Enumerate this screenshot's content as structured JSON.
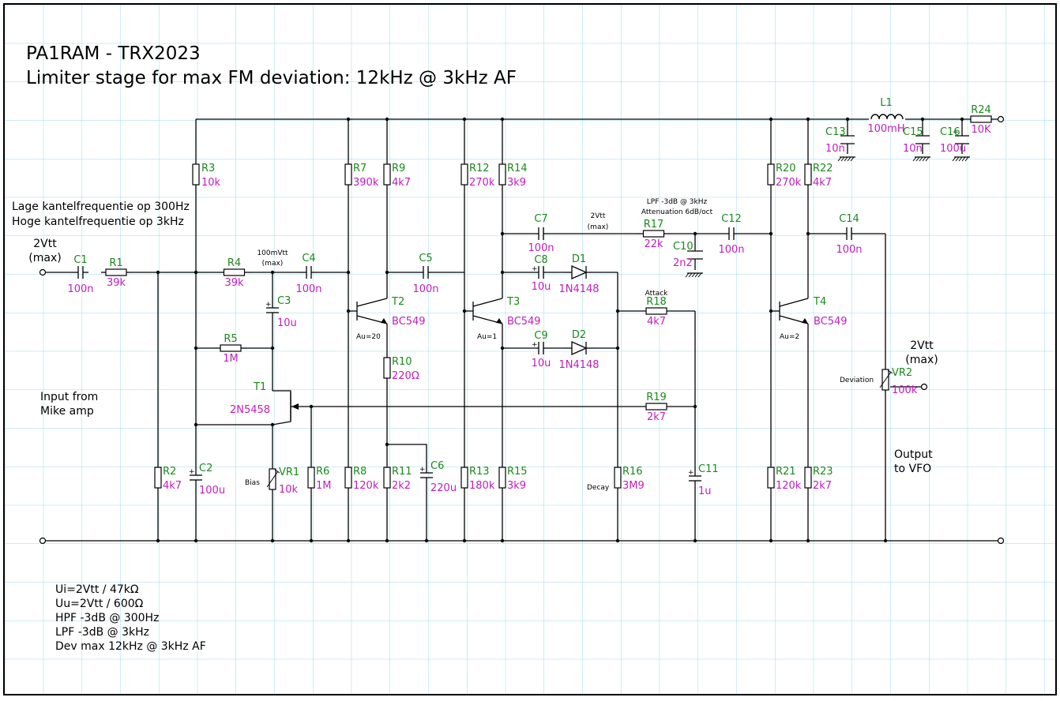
{
  "title": {
    "line1": "PA1RAM - TRX2023",
    "line2": "Limiter stage for max FM deviation: 12kHz @ 3kHz AF"
  },
  "notes": {
    "filter1": "Lage kantelfrequentie op 300Hz",
    "filter2": "Hoge kantelfrequentie op 3kHz",
    "input_level": "2Vtt",
    "input_level_max": "(max)",
    "input_from1": "Input from",
    "input_from2": "Mike amp",
    "mid_level": "100mVtt",
    "mid_level_max": "(max)",
    "lpf_note1": "LPF -3dB @ 3kHz",
    "lpf_note2": "Attenuation 6dB/oct",
    "c7_level": "2Vtt",
    "c7_level_max": "(max)",
    "out_level": "2Vtt",
    "out_level_max": "(max)",
    "output1": "Output",
    "output2": "to VFO",
    "gain_t2": "Au=20",
    "gain_t3": "Au=1",
    "gain_t4": "Au=2",
    "attack": "Attack",
    "decay": "Decay",
    "bias": "Bias",
    "deviation": "Deviation",
    "summary": [
      "Ui=2Vtt / 47kΩ",
      "Uu=2Vtt / 600Ω",
      "HPF -3dB @ 300Hz",
      "LPF -3dB @ 3kHz",
      "Dev max 12kHz @ 3kHz AF"
    ]
  },
  "components": {
    "R1": {
      "ref": "R1",
      "val": "39k"
    },
    "R2": {
      "ref": "R2",
      "val": "4k7"
    },
    "R3": {
      "ref": "R3",
      "val": "10k"
    },
    "R4": {
      "ref": "R4",
      "val": "39k"
    },
    "R5": {
      "ref": "R5",
      "val": "1M"
    },
    "R6": {
      "ref": "R6",
      "val": "1M"
    },
    "R7": {
      "ref": "R7",
      "val": "390k"
    },
    "R8": {
      "ref": "R8",
      "val": "120k"
    },
    "R9": {
      "ref": "R9",
      "val": "4k7"
    },
    "R10": {
      "ref": "R10",
      "val": "220Ω"
    },
    "R11": {
      "ref": "R11",
      "val": "2k2"
    },
    "R12": {
      "ref": "R12",
      "val": "270k"
    },
    "R13": {
      "ref": "R13",
      "val": "180k"
    },
    "R14": {
      "ref": "R14",
      "val": "3k9"
    },
    "R15": {
      "ref": "R15",
      "val": "3k9"
    },
    "R16": {
      "ref": "R16",
      "val": "3M9"
    },
    "R17": {
      "ref": "R17",
      "val": "22k"
    },
    "R18": {
      "ref": "R18",
      "val": "4k7"
    },
    "R19": {
      "ref": "R19",
      "val": "2k7"
    },
    "R20": {
      "ref": "R20",
      "val": "270k"
    },
    "R21": {
      "ref": "R21",
      "val": "120k"
    },
    "R22": {
      "ref": "R22",
      "val": "4k7"
    },
    "R23": {
      "ref": "R23",
      "val": "2k7"
    },
    "R24": {
      "ref": "R24",
      "val": "10K"
    },
    "C1": {
      "ref": "C1",
      "val": "100n"
    },
    "C2": {
      "ref": "C2",
      "val": "100u"
    },
    "C3": {
      "ref": "C3",
      "val": "10u"
    },
    "C4": {
      "ref": "C4",
      "val": "100n"
    },
    "C5": {
      "ref": "C5",
      "val": "100n"
    },
    "C6": {
      "ref": "C6",
      "val": "220u"
    },
    "C7": {
      "ref": "C7",
      "val": "100n"
    },
    "C8": {
      "ref": "C8",
      "val": "10u"
    },
    "C9": {
      "ref": "C9",
      "val": "10u"
    },
    "C10": {
      "ref": "C10",
      "val": "2n2"
    },
    "C11": {
      "ref": "C11",
      "val": "1u"
    },
    "C12": {
      "ref": "C12",
      "val": "100n"
    },
    "C13": {
      "ref": "C13",
      "val": "10n"
    },
    "C14": {
      "ref": "C14",
      "val": "100n"
    },
    "C15": {
      "ref": "C15",
      "val": "10n"
    },
    "C16": {
      "ref": "C16",
      "val": "100u"
    },
    "D1": {
      "ref": "D1",
      "val": "1N4148"
    },
    "D2": {
      "ref": "D2",
      "val": "1N4148"
    },
    "T1": {
      "ref": "T1",
      "val": "2N5458"
    },
    "T2": {
      "ref": "T2",
      "val": "BC549"
    },
    "T3": {
      "ref": "T3",
      "val": "BC549"
    },
    "T4": {
      "ref": "T4",
      "val": "BC549"
    },
    "L1": {
      "ref": "L1",
      "val": "100mH"
    },
    "VR1": {
      "ref": "VR1",
      "val": "10k"
    },
    "VR2": {
      "ref": "VR2",
      "val": "100k"
    }
  }
}
